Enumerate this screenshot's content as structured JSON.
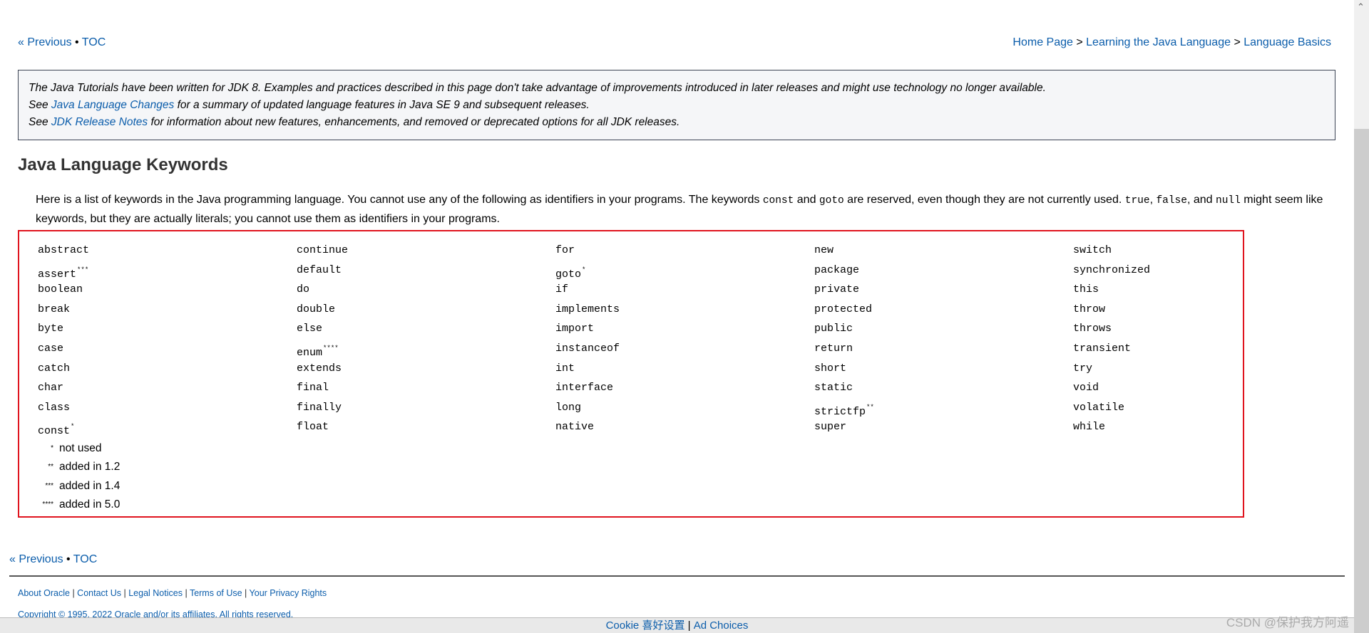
{
  "nav": {
    "previous": "« Previous",
    "sep": " • ",
    "toc": "TOC"
  },
  "breadcrumb": [
    "Home Page",
    "Learning the Java Language",
    "Language Basics"
  ],
  "breadcrumb_sep": " > ",
  "notice": {
    "line1": "The Java Tutorials have been written for JDK 8. Examples and practices described in this page don't take advantage of improvements introduced in later releases and might use technology no longer available.",
    "line2_pre": "See ",
    "line2_link": "Java Language Changes",
    "line2_post": " for a summary of updated language features in Java SE 9 and subsequent releases.",
    "line3_pre": "See ",
    "line3_link": "JDK Release Notes",
    "line3_post": " for information about new features, enhancements, and removed or deprecated options for all JDK releases."
  },
  "heading": "Java Language Keywords",
  "intro": {
    "t1": "Here is a list of keywords in the Java programming language. You cannot use any of the following as identifiers in your programs. The keywords ",
    "c1": "const",
    "t2": " and ",
    "c2": "goto",
    "t3": " are reserved, even though they are not currently used. ",
    "c3": "true",
    "t4": ", ",
    "c4": "false",
    "t5": ", and ",
    "c5": "null",
    "t6": " might seem like keywords, but they are actually literals; you cannot use them as identifiers in your programs."
  },
  "keywords": [
    [
      [
        "abstract",
        ""
      ],
      [
        "continue",
        ""
      ],
      [
        "for",
        ""
      ],
      [
        "new",
        ""
      ],
      [
        "switch",
        ""
      ]
    ],
    [
      [
        "assert",
        "***"
      ],
      [
        "default",
        ""
      ],
      [
        "goto",
        "*"
      ],
      [
        "package",
        ""
      ],
      [
        "synchronized",
        ""
      ]
    ],
    [
      [
        "boolean",
        ""
      ],
      [
        "do",
        ""
      ],
      [
        "if",
        ""
      ],
      [
        "private",
        ""
      ],
      [
        "this",
        ""
      ]
    ],
    [
      [
        "break",
        ""
      ],
      [
        "double",
        ""
      ],
      [
        "implements",
        ""
      ],
      [
        "protected",
        ""
      ],
      [
        "throw",
        ""
      ]
    ],
    [
      [
        "byte",
        ""
      ],
      [
        "else",
        ""
      ],
      [
        "import",
        ""
      ],
      [
        "public",
        ""
      ],
      [
        "throws",
        ""
      ]
    ],
    [
      [
        "case",
        ""
      ],
      [
        "enum",
        "****"
      ],
      [
        "instanceof",
        ""
      ],
      [
        "return",
        ""
      ],
      [
        "transient",
        ""
      ]
    ],
    [
      [
        "catch",
        ""
      ],
      [
        "extends",
        ""
      ],
      [
        "int",
        ""
      ],
      [
        "short",
        ""
      ],
      [
        "try",
        ""
      ]
    ],
    [
      [
        "char",
        ""
      ],
      [
        "final",
        ""
      ],
      [
        "interface",
        ""
      ],
      [
        "static",
        ""
      ],
      [
        "void",
        ""
      ]
    ],
    [
      [
        "class",
        ""
      ],
      [
        "finally",
        ""
      ],
      [
        "long",
        ""
      ],
      [
        "strictfp",
        "**"
      ],
      [
        "volatile",
        ""
      ]
    ],
    [
      [
        "const",
        "*"
      ],
      [
        "float",
        ""
      ],
      [
        "native",
        ""
      ],
      [
        "super",
        ""
      ],
      [
        "while",
        ""
      ]
    ]
  ],
  "legend": [
    [
      "*",
      "not used"
    ],
    [
      "**",
      "added in 1.2"
    ],
    [
      "***",
      "added in 1.4"
    ],
    [
      "****",
      "added in 5.0"
    ]
  ],
  "footer": {
    "links": [
      "About Oracle",
      "Contact Us",
      "Legal Notices",
      "Terms of Use",
      "Your Privacy Rights"
    ],
    "copyright": "Copyright © 1995, 2022 Oracle and/or its affiliates. All rights reserved."
  },
  "cookie": {
    "prefs": "Cookie 喜好设置",
    "sep": " | ",
    "ad": "Ad Choices"
  },
  "watermark": "CSDN @保护我方阿遥",
  "colors": {
    "link": "#0b5dab",
    "highlight_border": "#e0141e",
    "notice_bg": "#f5f6f8"
  }
}
